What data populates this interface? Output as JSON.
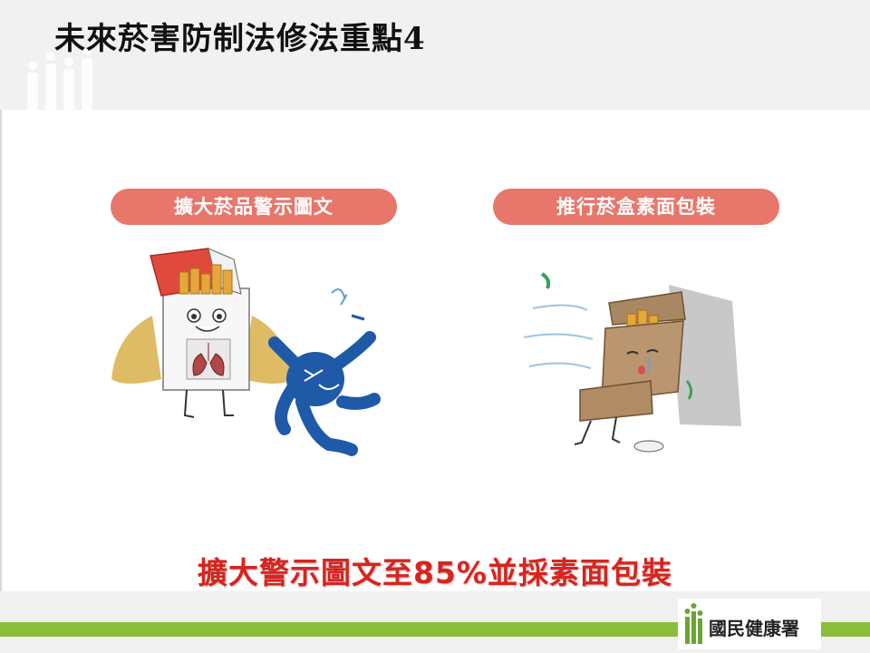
{
  "slide": {
    "title": "未來菸害防制法修法重點4"
  },
  "panels": [
    {
      "label": "擴大菸品警示圖文"
    },
    {
      "label": "推行菸盒素面包裝"
    }
  ],
  "summary": "擴大警示圖文至85%並採素面包裝",
  "footer": {
    "logo_text": "國民健康署"
  },
  "colors": {
    "pill": "#e8766b",
    "summary_text": "#d8241e",
    "stripe": "#8bbd3c"
  }
}
